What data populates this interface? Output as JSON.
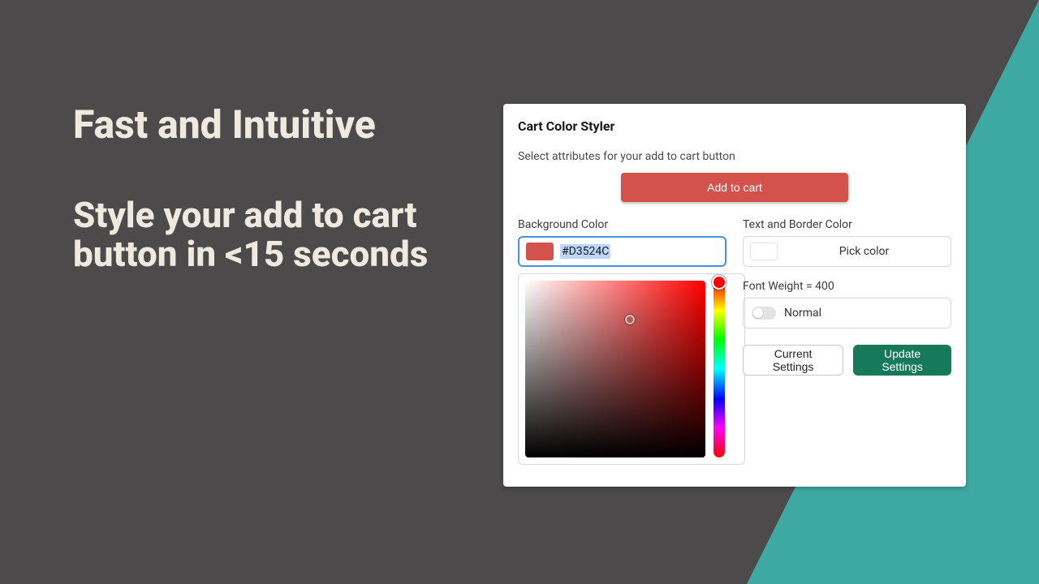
{
  "colors": {
    "accent_teal": "#3ea8a3",
    "cta_bg": "#D3524C",
    "update_bg": "#167a5a",
    "input_focus": "#4a90e2",
    "hero_text": "#efeadf",
    "stage_bg": "#4c4a4a"
  },
  "hero": {
    "line1": "Fast and Intuitive",
    "line2": "Style your add to cart button in <15 seconds"
  },
  "panel": {
    "title": "Cart Color Styler",
    "subtitle": "Select attributes for your add to cart button",
    "cta_label": "Add to cart",
    "bg_color": {
      "label": "Background Color",
      "hex": "#D3524C",
      "picker": {
        "hue_deg": 0,
        "sat_pct": 58,
        "val_pct": 78
      }
    },
    "text_border": {
      "label": "Text and Border Color",
      "placeholder": "Pick color"
    },
    "font_weight": {
      "label": "Font Weight = 400",
      "value_label": "Normal",
      "bold": false
    },
    "actions": {
      "current": "Current Settings",
      "update": "Update Settings"
    }
  }
}
